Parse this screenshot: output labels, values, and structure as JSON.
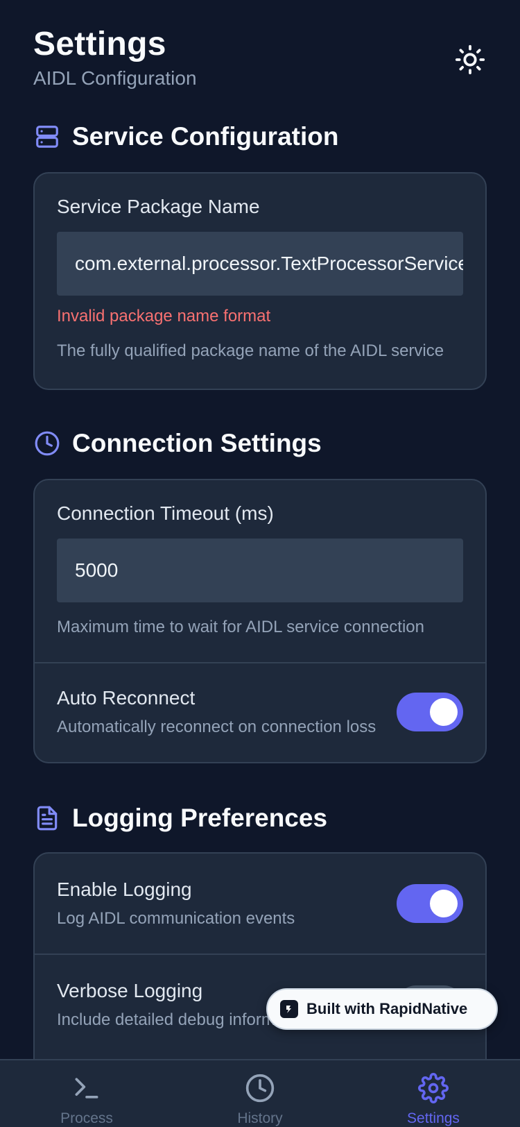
{
  "header": {
    "title": "Settings",
    "subtitle": "AIDL Configuration"
  },
  "sections": {
    "service": {
      "title": "Service Configuration",
      "package_label": "Service Package Name",
      "package_value": "com.external.processor.TextProcessorService",
      "error": "Invalid package name format",
      "help": "The fully qualified package name of the AIDL service"
    },
    "connection": {
      "title": "Connection Settings",
      "timeout_label": "Connection Timeout (ms)",
      "timeout_value": "5000",
      "timeout_help": "Maximum time to wait for AIDL service connection",
      "auto_reconnect_title": "Auto Reconnect",
      "auto_reconnect_desc": "Automatically reconnect on connection loss"
    },
    "logging": {
      "title": "Logging Preferences",
      "enable_title": "Enable Logging",
      "enable_desc": "Log AIDL communication events",
      "verbose_title": "Verbose Logging",
      "verbose_desc": "Include detailed debug information"
    }
  },
  "toggles": {
    "auto_reconnect": true,
    "enable_logging": true,
    "verbose_logging": false
  },
  "badge": {
    "text": "Built with RapidNative"
  },
  "tabs": [
    {
      "label": "Process",
      "icon": "terminal-icon",
      "active": false
    },
    {
      "label": "History",
      "icon": "clock-icon",
      "active": false
    },
    {
      "label": "Settings",
      "icon": "gear-icon",
      "active": true
    }
  ],
  "colors": {
    "background": "#0f172a",
    "card": "#1e293b",
    "accent": "#6366f1",
    "error": "#f87171",
    "muted": "#94a3b8"
  }
}
